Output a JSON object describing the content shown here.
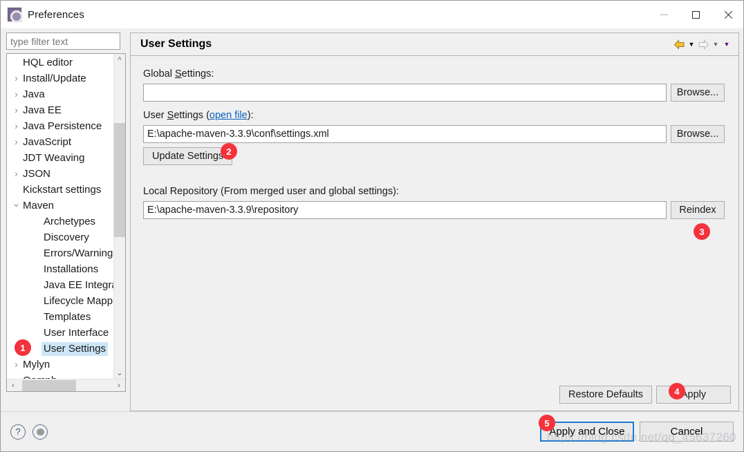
{
  "window": {
    "title": "Preferences",
    "icon": "gear-icon",
    "controls": {
      "minimize": "minimize-icon",
      "maximize": "maximize-icon",
      "close": "close-icon"
    }
  },
  "filter": {
    "placeholder": "type filter text",
    "value": ""
  },
  "tree": {
    "items": [
      {
        "label": "HQL editor",
        "indent": 1,
        "twisty": "none",
        "selected": false
      },
      {
        "label": "Install/Update",
        "indent": 1,
        "twisty": "right",
        "selected": false
      },
      {
        "label": "Java",
        "indent": 1,
        "twisty": "right",
        "selected": false
      },
      {
        "label": "Java EE",
        "indent": 1,
        "twisty": "right",
        "selected": false
      },
      {
        "label": "Java Persistence",
        "indent": 1,
        "twisty": "right",
        "selected": false
      },
      {
        "label": "JavaScript",
        "indent": 1,
        "twisty": "right",
        "selected": false
      },
      {
        "label": "JDT Weaving",
        "indent": 1,
        "twisty": "none",
        "selected": false
      },
      {
        "label": "JSON",
        "indent": 1,
        "twisty": "right",
        "selected": false
      },
      {
        "label": "Kickstart settings",
        "indent": 1,
        "twisty": "none",
        "selected": false
      },
      {
        "label": "Maven",
        "indent": 1,
        "twisty": "down",
        "selected": false
      },
      {
        "label": "Archetypes",
        "indent": 2,
        "twisty": "none",
        "selected": false
      },
      {
        "label": "Discovery",
        "indent": 2,
        "twisty": "none",
        "selected": false
      },
      {
        "label": "Errors/Warnings",
        "indent": 2,
        "twisty": "none",
        "selected": false
      },
      {
        "label": "Installations",
        "indent": 2,
        "twisty": "none",
        "selected": false
      },
      {
        "label": "Java EE Integration",
        "indent": 2,
        "twisty": "none",
        "selected": false
      },
      {
        "label": "Lifecycle Mappings",
        "indent": 2,
        "twisty": "none",
        "selected": false
      },
      {
        "label": "Templates",
        "indent": 2,
        "twisty": "none",
        "selected": false
      },
      {
        "label": "User Interface",
        "indent": 2,
        "twisty": "none",
        "selected": false
      },
      {
        "label": "User Settings",
        "indent": 2,
        "twisty": "none",
        "selected": true
      },
      {
        "label": "Mylyn",
        "indent": 1,
        "twisty": "right",
        "selected": false
      },
      {
        "label": "Oomph",
        "indent": 1,
        "twisty": "right",
        "selected": false
      }
    ],
    "scrollbar_up": "scroll-up-icon",
    "scrollbar_down": "scroll-down-icon",
    "scrollbar_left": "scroll-left-icon",
    "scrollbar_right": "scroll-right-icon"
  },
  "page": {
    "title": "User Settings",
    "nav": {
      "back": "back-arrow-icon",
      "back_menu": "chevron-down-icon",
      "forward": "forward-arrow-icon",
      "forward_menu": "chevron-down-icon",
      "more_menu": "chevron-down-icon"
    },
    "global_settings": {
      "label_prefix": "Global ",
      "label_mnemonic": "S",
      "label_suffix": "ettings:",
      "value": "",
      "browse_label": "Browse..."
    },
    "user_settings": {
      "label_prefix": "User ",
      "label_mnemonic": "S",
      "label_mid": "ettings (",
      "link_label": "open file",
      "label_suffix": "):",
      "value": "E:\\apache-maven-3.3.9\\conf\\settings.xml",
      "browse_label": "Browse...",
      "update_label": "Update Settings"
    },
    "local_repository": {
      "label": "Local Repository (From merged user and global settings):",
      "value": "E:\\apache-maven-3.3.9\\repository",
      "reindex_label": "Reindex"
    },
    "restore_defaults_label": "Restore Defaults",
    "apply_label": "Apply"
  },
  "footer": {
    "help_icon": "help-icon",
    "pin_icon": "pin-icon",
    "apply_and_close_label": "Apply and Close",
    "cancel_label": "Cancel"
  },
  "badges": {
    "one": "1",
    "two": "2",
    "three": "3",
    "four": "4",
    "five": "5",
    "color": "#f4333c"
  },
  "watermark": "https://blog.csdn.net/qq_45637260"
}
